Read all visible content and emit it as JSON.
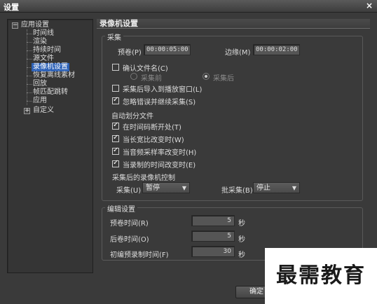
{
  "window": {
    "title": "设置",
    "close_glyph": "×"
  },
  "tree": {
    "root_label": "应用设置",
    "root_expander": "−",
    "items": [
      "时间线",
      "渲染",
      "持续时间",
      "源文件",
      "录像机设置",
      "恢复离线素材",
      "回放",
      "帧匹配跳转",
      "应用"
    ],
    "selected": "录像机设置",
    "custom_label": "自定义",
    "custom_expander": "+"
  },
  "panel": {
    "title": "录像机设置"
  },
  "capture": {
    "group_label": "采集",
    "preroll_label": "预卷(P)",
    "preroll_value": "00:00:05:00",
    "margin_label": "边缘(M)",
    "margin_value": "00:00:02:00",
    "confirm_filename_label": "确认文件名(C)",
    "confirm_filename_checked": false,
    "before_capture_label": "采集前",
    "after_capture_label": "采集后",
    "selected_radio": "after",
    "import_to_player_label": "采集后导入到播放窗口(L)",
    "import_to_player_checked": false,
    "ignore_errors_label": "忽略错误并继续采集(S)",
    "ignore_errors_checked": true,
    "auto_split_heading": "自动划分文件",
    "split_options": [
      {
        "label": "在时间码断开处(T)",
        "checked": true
      },
      {
        "label": "当长宽比改变时(W)",
        "checked": true
      },
      {
        "label": "当音频采样率改变时(H)",
        "checked": true
      },
      {
        "label": "当录制的时间改变时(E)",
        "checked": true
      }
    ],
    "deck_control_heading": "采集后的录像机控制",
    "capture_label": "采集(U)",
    "capture_value": "暂停",
    "batch_label": "批采集(B)",
    "batch_value": "停止"
  },
  "edit": {
    "group_label": "编辑设置",
    "rows": [
      {
        "label": "预卷时间(R)",
        "value": "5",
        "unit": "秒"
      },
      {
        "label": "后卷时间(O)",
        "value": "5",
        "unit": "秒"
      },
      {
        "label": "初编预录制时间(F)",
        "value": "30",
        "unit": "秒"
      }
    ]
  },
  "buttons": {
    "ok": "确定"
  },
  "watermark": "最需教育"
}
